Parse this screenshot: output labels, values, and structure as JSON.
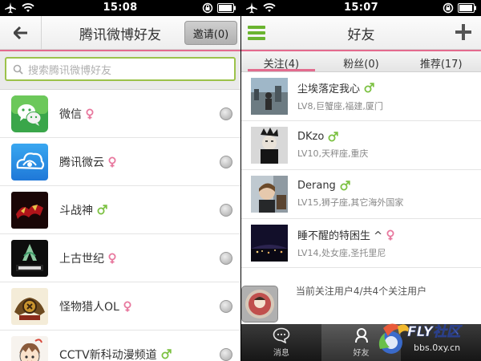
{
  "left_screen": {
    "status": {
      "time": "15:08"
    },
    "header": {
      "title": "腾讯微博好友",
      "invite_label": "邀请(0)"
    },
    "search": {
      "placeholder": "搜索腾讯微博好友"
    },
    "friends": [
      {
        "name": "微信",
        "gender": "female",
        "icon": "wechat-icon"
      },
      {
        "name": "腾讯微云",
        "gender": "female",
        "icon": "weiyun-cloud-icon"
      },
      {
        "name": "斗战神",
        "gender": "male",
        "icon": "game-logo-icon"
      },
      {
        "name": "上古世纪",
        "gender": "female",
        "icon": "archeage-logo-icon"
      },
      {
        "name": "怪物猎人OL",
        "gender": "female",
        "icon": "monster-hunter-icon"
      },
      {
        "name": "CCTV新科动漫频道",
        "gender": "male",
        "icon": "anime-avatar-icon"
      }
    ]
  },
  "right_screen": {
    "status": {
      "time": "15:07"
    },
    "header": {
      "title": "好友"
    },
    "tabs": [
      {
        "label": "关注(4)",
        "active": true
      },
      {
        "label": "粉丝(0)",
        "active": false
      },
      {
        "label": "推荐(17)",
        "active": false
      }
    ],
    "users": [
      {
        "name": "尘埃落定我心",
        "gender": "male",
        "meta": "LV8,巨蟹座,福建,厦门"
      },
      {
        "name": "DKzo",
        "gender": "male",
        "meta": "LV10,天秤座,重庆"
      },
      {
        "name": "Derang",
        "gender": "male",
        "meta": "LV15,狮子座,其它海外国家"
      },
      {
        "name": "睡不醒的特困生 ^",
        "gender": "female",
        "meta": "LV14,处女座,圣托里尼"
      }
    ],
    "summary": "当前关注用户4/共4个关注用户",
    "tabbar": [
      {
        "label": "消息",
        "icon": "message-bubble-icon",
        "active": false
      },
      {
        "label": "好友",
        "icon": "friends-icon",
        "active": true
      },
      {
        "label": "",
        "icon": "",
        "active": false
      }
    ]
  },
  "watermark": {
    "brand": "FLY社区",
    "site": "bbs.0xy.cn"
  },
  "colors": {
    "accent_pink": "#e36b8e",
    "accent_green": "#6ab42f",
    "male": "#7cc142",
    "female": "#e8789e"
  }
}
